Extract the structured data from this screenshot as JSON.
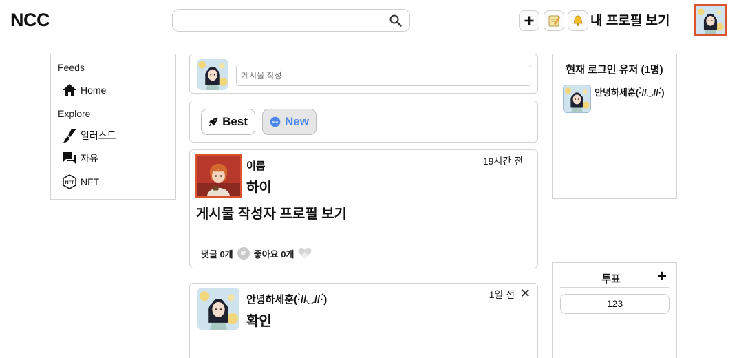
{
  "header": {
    "logo": "NCC",
    "search_placeholder": "",
    "add_icon": "plus-icon",
    "write_icon": "memo-icon",
    "notify_icon": "bell-icon",
    "profile_link": "내 프로필 보기"
  },
  "sidebar": {
    "feeds_title": "Feeds",
    "home": "Home",
    "explore_title": "Explore",
    "items": [
      {
        "label": "일러스트",
        "icon": "brush-icon"
      },
      {
        "label": "자유",
        "icon": "chat-icon"
      },
      {
        "label": "NFT",
        "icon": "nft-icon"
      }
    ]
  },
  "composer": {
    "placeholder": "게시물 작성"
  },
  "tabs": {
    "best": "Best",
    "new": "New"
  },
  "posts": [
    {
      "author": "이름",
      "title": "하이",
      "time": "19시간 전",
      "body": "게시물 작성자 프로필 보기",
      "comments": "댓글 0개",
      "likes": "좋아요 0개"
    },
    {
      "author": "안녕하세훈(·̀//◡//·́)",
      "title": "확인",
      "time": "1일 전",
      "close": "✕"
    }
  ],
  "online": {
    "title": "현재 로그인 유저 (1명)",
    "users": [
      "안녕하세훈(·̀//◡//·́)"
    ]
  },
  "vote": {
    "title": "투표",
    "add": "+",
    "items": [
      "123"
    ]
  },
  "colors": {
    "accent": "#d9532c",
    "new_tab": "#4a86ef",
    "border": "#d3d3d3"
  }
}
